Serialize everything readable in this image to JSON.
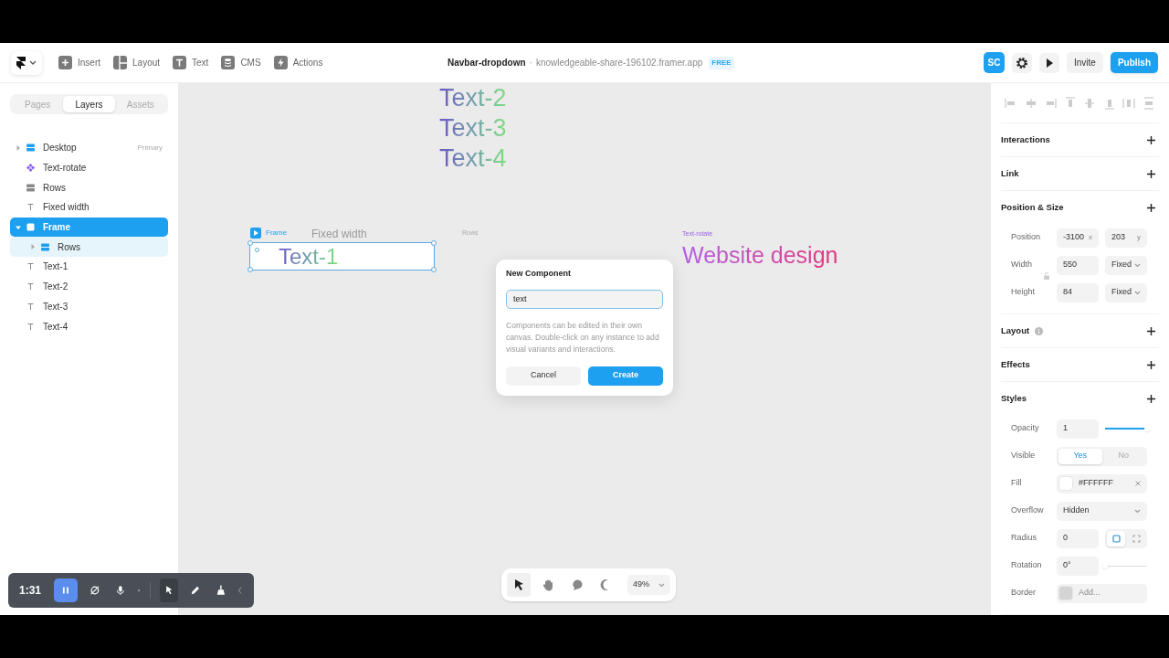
{
  "toolbar": {
    "items": [
      {
        "label": "Insert",
        "kind": "plus"
      },
      {
        "label": "Layout",
        "kind": "layout"
      },
      {
        "label": "Text",
        "kind": "text"
      },
      {
        "label": "CMS",
        "kind": "cms"
      },
      {
        "label": "Actions",
        "kind": "bolt"
      }
    ]
  },
  "project": {
    "name": "Navbar-dropdown",
    "separator": "·",
    "domain": "knowledgeable-share-196102.framer.app",
    "badge": "FREE"
  },
  "actions": {
    "avatar": "SC",
    "invite": "Invite",
    "publish": "Publish"
  },
  "sidebar": {
    "tabs": [
      {
        "label": "Pages",
        "selected": false
      },
      {
        "label": "Layers",
        "selected": true
      },
      {
        "label": "Assets",
        "selected": false
      }
    ],
    "layers": [
      {
        "label": "Desktop",
        "kind": "stack",
        "note": "Primary",
        "expanded": false,
        "selected": false
      },
      {
        "label": "Text-rotate",
        "kind": "component",
        "selected": false
      },
      {
        "label": "Rows",
        "kind": "stack",
        "selected": false
      },
      {
        "label": "Fixed width",
        "kind": "text",
        "selected": false
      },
      {
        "label": "Frame",
        "kind": "frame",
        "expanded": true,
        "selected": true,
        "children": [
          {
            "label": "Rows",
            "kind": "stack",
            "expanded": false,
            "selected": false
          }
        ]
      },
      {
        "label": "Text-1",
        "kind": "text",
        "selected": false
      },
      {
        "label": "Text-2",
        "kind": "text",
        "selected": false
      },
      {
        "label": "Text-3",
        "kind": "text",
        "selected": false
      },
      {
        "label": "Text-4",
        "kind": "text",
        "selected": false
      }
    ]
  },
  "canvas": {
    "stacked_texts": [
      "Text-2",
      "Text-3",
      "Text-4"
    ],
    "frame": {
      "label": "Frame",
      "text": "Text-1"
    },
    "fixed_width_label": "Fixed width",
    "rows_label": "Rows",
    "text_rotate": {
      "label": "Text-rotate",
      "text": "Website design"
    },
    "dialog": {
      "title": "New Component",
      "value": "text",
      "description": "Components can be edited in their own canvas. Double-click on any instance to add visual variants and interactions.",
      "cancel": "Cancel",
      "create": "Create"
    },
    "tools": [
      {
        "kind": "pointer",
        "selected": true
      },
      {
        "kind": "hand",
        "selected": false
      },
      {
        "kind": "comment",
        "selected": false
      },
      {
        "kind": "moon",
        "selected": false
      }
    ],
    "zoom": "49%"
  },
  "recorder": {
    "time": "1:31",
    "tools": [
      {
        "kind": "pause",
        "selected": true
      },
      {
        "kind": "camera-off",
        "selected": false
      },
      {
        "kind": "mic",
        "selected": false
      },
      {
        "kind": "pointer",
        "selected": true
      },
      {
        "kind": "pencil",
        "selected": false
      },
      {
        "kind": "broom",
        "selected": false
      }
    ]
  },
  "properties": {
    "sections": [
      {
        "title": "Interactions"
      },
      {
        "title": "Link"
      },
      {
        "title": "Position & Size",
        "rows": [
          {
            "kind": "pair",
            "label": "Position",
            "a": "-3100",
            "a_unit": "x",
            "b": "203",
            "b_unit": "y"
          },
          {
            "kind": "size",
            "label": "Width",
            "value": "550",
            "mode": "Fixed"
          },
          {
            "kind": "size",
            "label": "Height",
            "value": "84",
            "mode": "Fixed"
          }
        ]
      },
      {
        "title": "Layout",
        "info": true
      },
      {
        "title": "Effects"
      },
      {
        "title": "Styles",
        "rows": [
          {
            "kind": "slider",
            "label": "Opacity",
            "value": "1",
            "level": 1
          },
          {
            "kind": "segmented",
            "label": "Visible",
            "options": [
              {
                "label": "Yes",
                "selected": true
              },
              {
                "label": "No",
                "selected": false
              }
            ]
          },
          {
            "kind": "color",
            "label": "Fill",
            "color": "#ffffff",
            "value": "#FFFFFF"
          },
          {
            "kind": "select",
            "label": "Overflow",
            "value": "Hidden"
          },
          {
            "kind": "radius",
            "label": "Radius",
            "value": "0",
            "modes": [
              {
                "selected": true
              },
              {
                "selected": false
              }
            ]
          },
          {
            "kind": "slider",
            "label": "Rotation",
            "value": "0°",
            "level": 0
          },
          {
            "kind": "color",
            "label": "Border",
            "color": "#d4d4d4",
            "placeholder": "Add..."
          }
        ]
      }
    ]
  }
}
